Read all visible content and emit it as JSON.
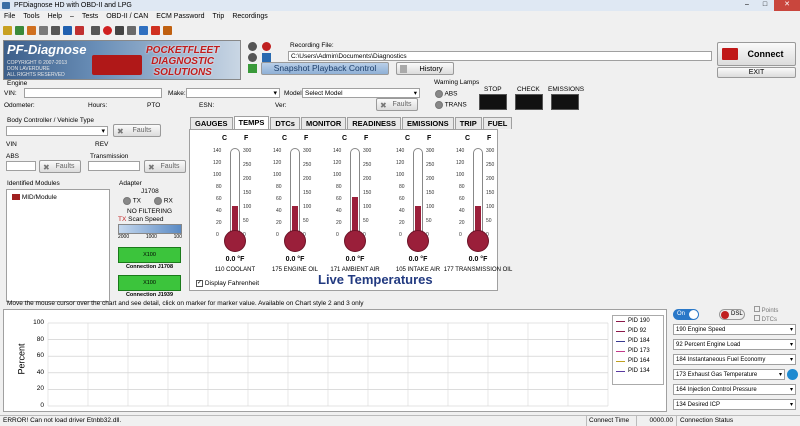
{
  "window": {
    "title": "PFDiagnose HD with OBD-II and LPG",
    "minimize": "–",
    "maximize": "□",
    "close": "✕"
  },
  "menu": [
    "File",
    "Tools",
    "Help",
    "–",
    "Tests",
    "OBD-II / CAN",
    "ECM Password",
    "Trip",
    "Recordings"
  ],
  "toolbar_icons": [
    "open-icon",
    "save-icon",
    "print-icon",
    "settings-icon",
    "record-icon",
    "stop-icon",
    "camera-icon",
    "help-icon"
  ],
  "logo": {
    "title": "PF-Diagnose",
    "sub": "COPYRIGHT © 2007-2013\nDON LAVERDURE\nALL RIGHTS RESERVED",
    "brand": "POCKETFLEET\nDIAGNOSTIC\nSOLUTIONS"
  },
  "recording": {
    "label": "Recording File:",
    "path": "C:\\Users\\Admin\\Documents\\Diagnostics",
    "snapshot": "Snapshot Playback Control",
    "history": "History"
  },
  "buttons": {
    "connect": "Connect",
    "exit": "EXIT"
  },
  "engine": {
    "section": "Engine",
    "vin": "VIN:",
    "make": "Make:",
    "model": "Model",
    "model_value": "Select Model",
    "odometer": "Odometer:",
    "hours": "Hours:",
    "pto": "PTO",
    "esn": "ESN:",
    "ver": "Ver:",
    "faults": "Faults"
  },
  "warning": {
    "label": "Warning Lamps",
    "abs": "ABS",
    "trans": "TRANS",
    "stop": "STOP",
    "check": "CHECK",
    "emissions": "EMISSIONS"
  },
  "body": {
    "label": "Body Controller / Vehicle Type",
    "faults": "Faults",
    "vin": "VIN",
    "rev": "REV",
    "abs": "ABS",
    "transmission": "Transmission"
  },
  "modules": {
    "label": "Identified Modules",
    "item": "MID/Module"
  },
  "adapter": {
    "label": "Adapter",
    "proto": "J1708",
    "tx": "TX",
    "rx": "RX",
    "filter": "NO FILTERING",
    "scan": "Scan Speed",
    "scale": [
      "2000",
      "1000",
      "100"
    ],
    "c1": "Connection J1708",
    "c2": "Connection J1939",
    "c1v": "X100",
    "c2v": "X100"
  },
  "tabs": [
    "GAUGES",
    "TEMPS",
    "DTCs",
    "MONITOR",
    "READINESS",
    "EMISSIONS",
    "TRIP",
    "FUEL"
  ],
  "active_tab": "TEMPS",
  "thermometers": [
    {
      "label": "110 COOLANT",
      "value": "0.0 °F",
      "fill": 0.35
    },
    {
      "label": "175 ENGINE OIL",
      "value": "0.0 °F",
      "fill": 0.35
    },
    {
      "label": "171 AMBIENT AIR",
      "value": "0.0 °F",
      "fill": 0.45
    },
    {
      "label": "105 INTAKE AIR",
      "value": "0.0 °F",
      "fill": 0.35
    },
    {
      "label": "177 TRANSMISSION OIL",
      "value": "0.0 °F",
      "fill": 0.35
    }
  ],
  "scale": {
    "c": "C",
    "f": "F",
    "c_ticks": [
      "140",
      "120",
      "100",
      "80",
      "60",
      "40",
      "20",
      "0"
    ],
    "f_ticks": [
      "300",
      "250",
      "200",
      "150",
      "100",
      "50",
      "0"
    ]
  },
  "display_f": "Display Fahrenheit",
  "caption": "Live Temperatures",
  "chart": {
    "note": "Move the mouse cursor over the chart and see detail, click on marker for marker value. Available on Chart style 2 and 3 only",
    "ylabel": "Percent",
    "yticks": [
      "100",
      "80",
      "60",
      "40",
      "20",
      "0"
    ]
  },
  "legend": [
    {
      "name": "PID 190",
      "color": "#8b1a4a"
    },
    {
      "name": "PID 92",
      "color": "#8b1a4a"
    },
    {
      "name": "PID 184",
      "color": "#3a3a90"
    },
    {
      "name": "PID 173",
      "color": "#c23a8a"
    },
    {
      "name": "PID 164",
      "color": "#c0a020"
    },
    {
      "name": "PID 134",
      "color": "#5a3aa0"
    }
  ],
  "toggles": {
    "on": "On",
    "dsl": "DSL",
    "points": "Points",
    "dtcs": "DTCs"
  },
  "selects": [
    "190 Engine Speed",
    "92 Percent Engine Load",
    "184 Instantaneous Fuel Economy",
    "173 Exhaust Gas Temperature",
    "164 Injection Control Pressure",
    "134 Desired ICP"
  ],
  "status": {
    "error": "ERROR! Can not load driver Etnbb32.dll.",
    "conn_time_label": "Connect Time",
    "conn_time": "0000.00",
    "conn_status": "Connection Status"
  }
}
